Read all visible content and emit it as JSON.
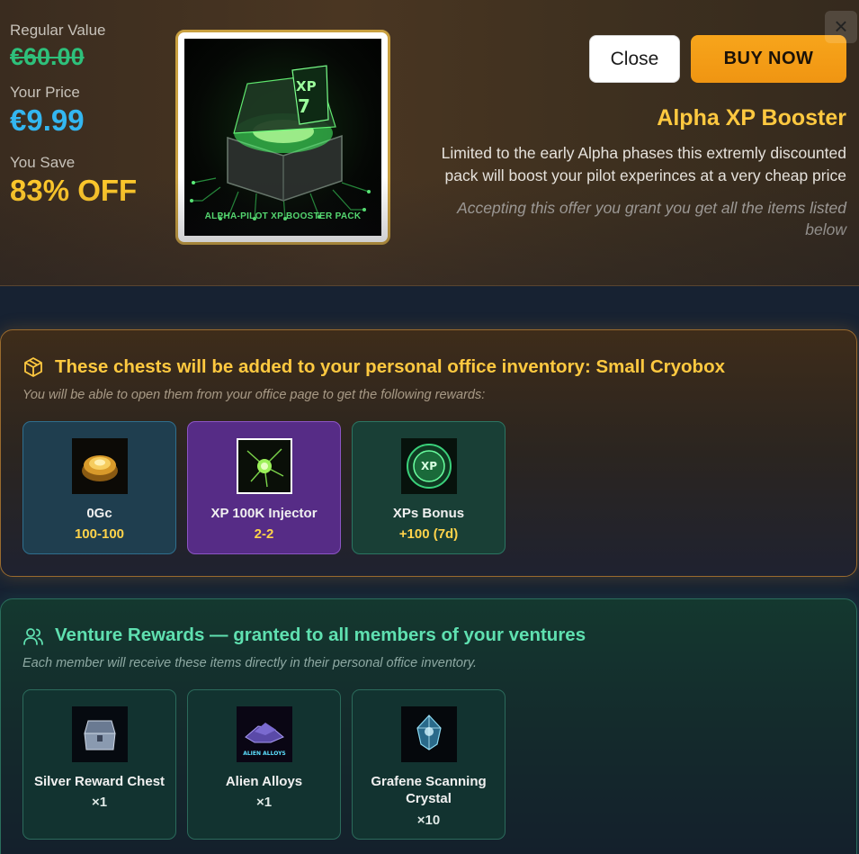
{
  "pricing": {
    "regular_label": "Regular Value",
    "regular_value": "€60.00",
    "your_price_label": "Your Price",
    "your_price": "€9.99",
    "save_label": "You Save",
    "save_value": "83% OFF"
  },
  "pack_image": {
    "caption": "ALPHA-PILOT XP BOOSTER PACK",
    "badge": "XP 7"
  },
  "actions": {
    "close_icon": "×",
    "close_label": "Close",
    "buy_label": "BUY NOW"
  },
  "product": {
    "title": "Alpha XP Booster",
    "description": "Limited to the early Alpha phases this extremly discounted pack will boost your pilot experinces at a very cheap price",
    "note": "Accepting this offer you grant you get all the items listed below"
  },
  "chests_section": {
    "icon": "box-icon",
    "title": "These chests will be added to your personal office inventory: Small Cryobox",
    "subtitle": "You will be able to open them from your office page to get the following rewards:",
    "items": [
      {
        "name": "0Gc",
        "qty": "100-100",
        "icon": "gold-coins-icon",
        "color": "#1f3e4f"
      },
      {
        "name": "XP 100K Injector",
        "qty": "2-2",
        "icon": "xp-injector-icon",
        "color": "#562c86"
      },
      {
        "name": "XPs Bonus",
        "qty": "+100 (7d)",
        "icon": "xp-bonus-icon",
        "color": "#193f36"
      }
    ]
  },
  "venture_section": {
    "icon": "users-icon",
    "title": "Venture Rewards — granted to all members of your ventures",
    "subtitle": "Each member will receive these items directly in their personal office inventory.",
    "items": [
      {
        "name": "Silver Reward Chest",
        "qty": "×1",
        "icon": "silver-chest-icon"
      },
      {
        "name": "Alien Alloys",
        "qty": "×1",
        "icon": "alien-alloys-icon",
        "thumb_text": "ALIEN ALLOYS"
      },
      {
        "name": "Grafene Scanning Crystal",
        "qty": "×10",
        "icon": "scanning-crystal-icon"
      }
    ]
  },
  "colors": {
    "accent_gold": "#ffc940",
    "price_blue": "#33b6f0",
    "old_price_green": "#2ec07b",
    "buy_orange": "#f7a51b",
    "venture_green": "#5fe0b0"
  }
}
